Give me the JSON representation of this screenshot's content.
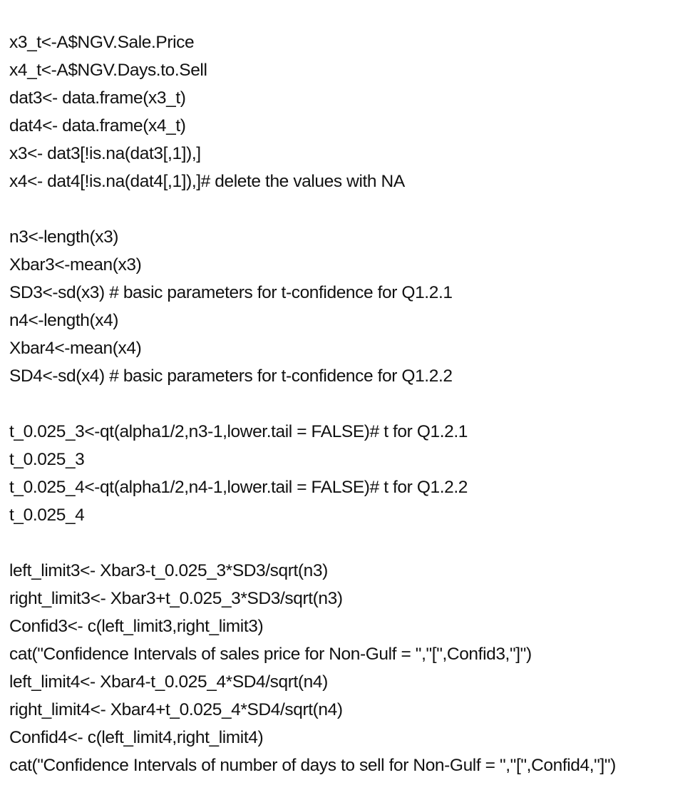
{
  "code": {
    "block1": [
      "x3_t<-A$NGV.Sale.Price",
      "x4_t<-A$NGV.Days.to.Sell",
      "dat3<- data.frame(x3_t)",
      "dat4<- data.frame(x4_t)",
      "x3<- dat3[!is.na(dat3[,1]),]",
      "x4<- dat4[!is.na(dat4[,1]),]# delete the values with NA"
    ],
    "block2": [
      "n3<-length(x3)",
      "Xbar3<-mean(x3)",
      "SD3<-sd(x3) # basic parameters for t-confidence for Q1.2.1",
      "n4<-length(x4)",
      "Xbar4<-mean(x4)",
      "SD4<-sd(x4) # basic parameters for t-confidence for Q1.2.2"
    ],
    "block3": [
      "t_0.025_3<-qt(alpha1/2,n3-1,lower.tail = FALSE)# t for Q1.2.1",
      "t_0.025_3",
      "t_0.025_4<-qt(alpha1/2,n4-1,lower.tail = FALSE)# t for Q1.2.2",
      "t_0.025_4"
    ],
    "block4": [
      "left_limit3<- Xbar3-t_0.025_3*SD3/sqrt(n3)",
      "right_limit3<- Xbar3+t_0.025_3*SD3/sqrt(n3)",
      "Confid3<- c(left_limit3,right_limit3)",
      "cat(\"Confidence Intervals of sales price for Non-Gulf = \",\"[\",Confid3,\"]\")",
      "left_limit4<- Xbar4-t_0.025_4*SD4/sqrt(n4)",
      "right_limit4<- Xbar4+t_0.025_4*SD4/sqrt(n4)",
      "Confid4<- c(left_limit4,right_limit4)",
      "cat(\"Confidence Intervals of number of days to sell for Non-Gulf = \",\"[\",Confid4,\"]\")"
    ]
  }
}
